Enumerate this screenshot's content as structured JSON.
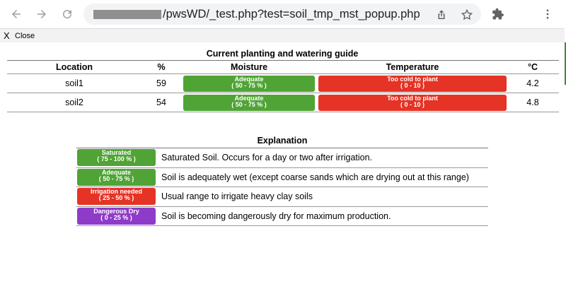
{
  "browser": {
    "url_visible": "/pwsWD/_test.php?test=soil_tmp_mst_popup.php"
  },
  "popup": {
    "close_icon": "X",
    "close_label": "Close"
  },
  "guide": {
    "title": "Current planting and watering guide",
    "headers": {
      "location": "Location",
      "percent": "%",
      "moisture": "Moisture",
      "temperature": "Temperature",
      "unit": "°C"
    },
    "rows": [
      {
        "location": "soil1",
        "percent": "59",
        "moisture_label": "Adequate",
        "moisture_range": "( 50 - 75 % )",
        "temp_label": "Too cold to plant",
        "temp_range": "( 0 - 10 )",
        "temp": "4.2"
      },
      {
        "location": "soil2",
        "percent": "54",
        "moisture_label": "Adequate",
        "moisture_range": "( 50 - 75 % )",
        "temp_label": "Too cold to plant",
        "temp_range": "( 0 - 10 )",
        "temp": "4.8"
      }
    ]
  },
  "explanation": {
    "title": "Explanation",
    "rows": [
      {
        "label": "Saturated",
        "range": "( 75 - 100 % )",
        "text": "Saturated Soil. Occurs for a day or two after irrigation.",
        "color": "#4fa435"
      },
      {
        "label": "Adequate",
        "range": "( 50 - 75 % )",
        "text": "Soil is adequately wet (except coarse sands which are drying out at this range)",
        "color": "#4fa435"
      },
      {
        "label": "Irrigation needed",
        "range": "( 25 - 50 % )",
        "text": "Usual range to irrigate heavy clay soils",
        "color": "#e53325"
      },
      {
        "label": "Dangerous Dry",
        "range": "( 0 - 25 % )",
        "text": "Soil is becoming dangerously dry for maximum production.",
        "color": "#8f3bc9"
      }
    ]
  },
  "colors": {
    "good": "#4fa435",
    "bad": "#e53325",
    "danger": "#8f3bc9"
  }
}
